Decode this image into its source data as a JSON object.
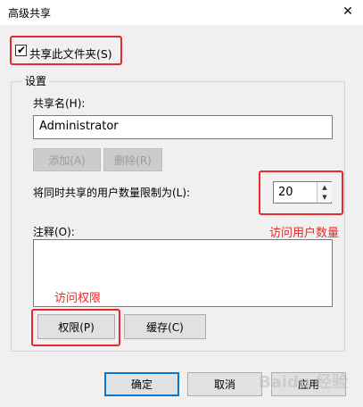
{
  "window": {
    "title": "高级共享",
    "close_glyph": "✕"
  },
  "share_checkbox": {
    "label": "共享此文件夹(S)",
    "checked": true
  },
  "settings": {
    "group_label": "设置",
    "share_name_label": "共享名(H):",
    "share_name_value": "Administrator",
    "add_button": "添加(A)",
    "remove_button": "删除(R)",
    "user_limit_label": "将同时共享的用户数量限制为(L):",
    "user_limit_value": "20",
    "comment_label": "注释(O):",
    "comment_value": "",
    "permissions_button": "权限(P)",
    "caching_button": "缓存(C)"
  },
  "footer": {
    "ok_button": "确定",
    "cancel_button": "取消",
    "apply_button": "应用"
  },
  "annotations": {
    "user_count_note": "访问用户数量",
    "permissions_note": "访问权限"
  },
  "watermark": {
    "text": "Baidu 经验"
  },
  "colors": {
    "highlight": "#e8292b",
    "focus": "#0078d7",
    "dialog_bg": "#f0f0f0"
  }
}
